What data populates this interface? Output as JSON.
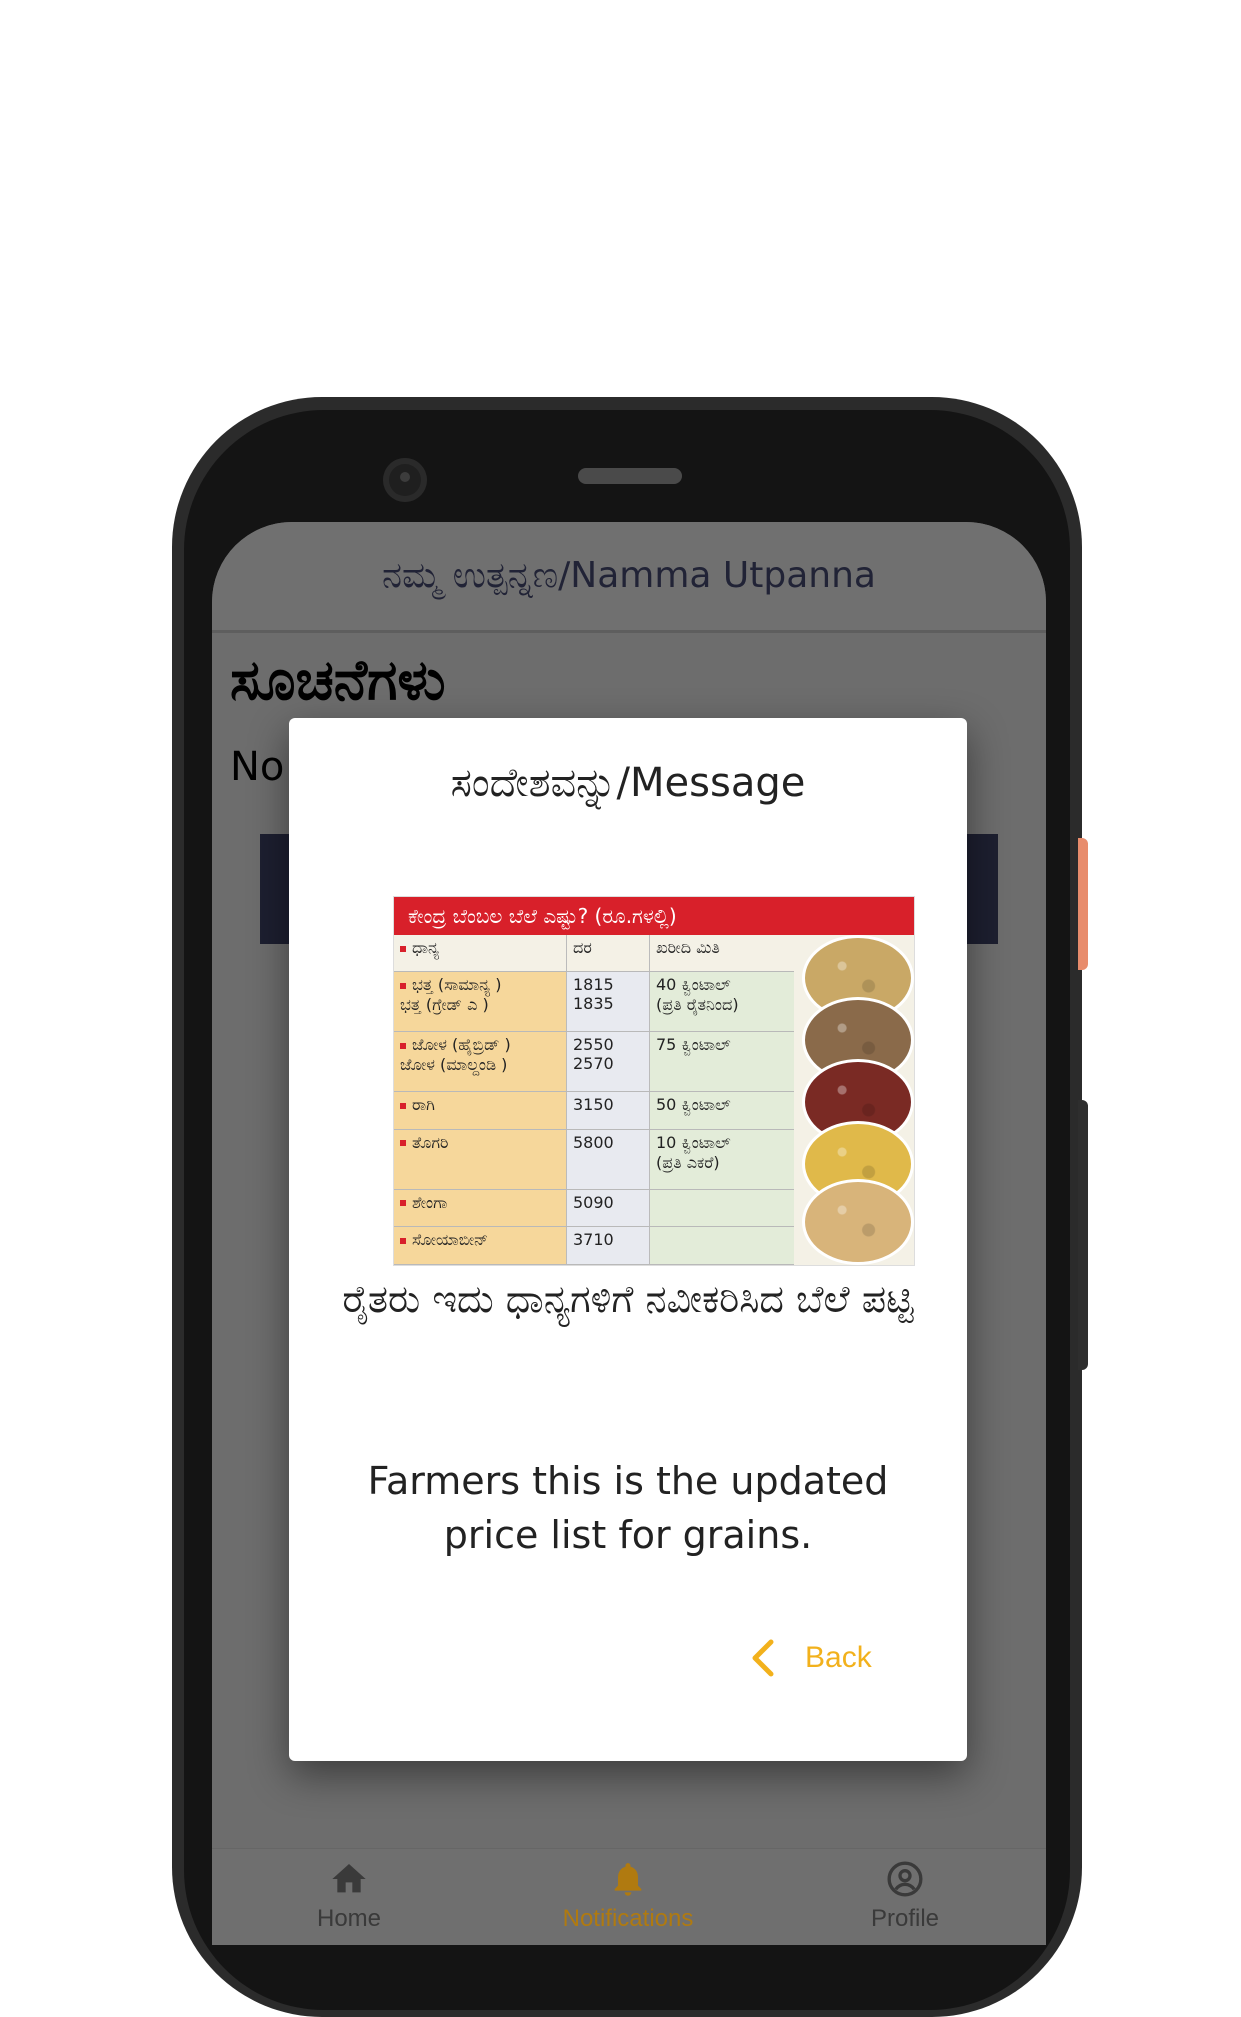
{
  "app": {
    "title": "ನಮ್ಮ ಉತ್ಪನ್ನಣ/Namma Utpanna"
  },
  "page": {
    "heading": "ಸೂಚನೆಗಳು",
    "subtext_partial": "No"
  },
  "dialog": {
    "title": "ಸಂದೇಶವನ್ನು/Message",
    "image": {
      "header": "ಕೇಂದ್ರ ಬೆಂಬಲ ಬೆಲೆ ಎಷ್ಟು? (ರೂ.ಗಳಲ್ಲಿ)",
      "columns": [
        "ಧಾನ್ಯ",
        "ದರ",
        "ಖರೀದಿ ಮಿತಿ"
      ],
      "rows": [
        {
          "name": "ಭತ್ತ (ಸಾಮಾನ್ಯ )\nಭತ್ತ (ಗ್ರೇಡ್ ಎ )",
          "price": "1815\n1835",
          "qty": "40 ಕ್ವಿಂಟಾಲ್\n(ಪ್ರತಿ ರೈತನಿಂದ)"
        },
        {
          "name": "ಜೋಳ (ಹೈಬ್ರಿಡ್ )\nಜೋಳ (ಮಾಲ್ದಂಡಿ )",
          "price": "2550\n2570",
          "qty": "75 ಕ್ವಿಂಟಾಲ್"
        },
        {
          "name": "ರಾಗಿ",
          "price": "3150",
          "qty": "50 ಕ್ವಿಂಟಾಲ್"
        },
        {
          "name": "ತೊಗರಿ",
          "price": "5800",
          "qty": "10 ಕ್ವಿಂಟಾಲ್\n(ಪ್ರತಿ ಎಕರೆ)"
        },
        {
          "name": "ಶೇಂಗಾ",
          "price": "5090",
          "qty": ""
        },
        {
          "name": "ಸೋಯಾಬೀನ್",
          "price": "3710",
          "qty": ""
        }
      ],
      "grain_colors": [
        "#c9a866",
        "#8a6a4a",
        "#7a2a24",
        "#e0b94a",
        "#d8b47a"
      ]
    },
    "message_kn": "ರೈತರು ಇದು ಧಾನ್ಯಗಳಿಗೆ ನವೀಕರಿಸಿದ ಬೆಲೆ ಪಟ್ಟಿ",
    "message_en": "Farmers this is the updated price list for grains.",
    "back_label": "Back",
    "back_icon": "chevron-left-icon",
    "accent_color": "#f2b11c"
  },
  "bottom_nav": {
    "items": [
      {
        "label": "Home",
        "icon": "home-icon",
        "active": false
      },
      {
        "label": "Notifications",
        "icon": "bell-icon",
        "active": true
      },
      {
        "label": "Profile",
        "icon": "account-circle-icon",
        "active": false
      }
    ]
  }
}
